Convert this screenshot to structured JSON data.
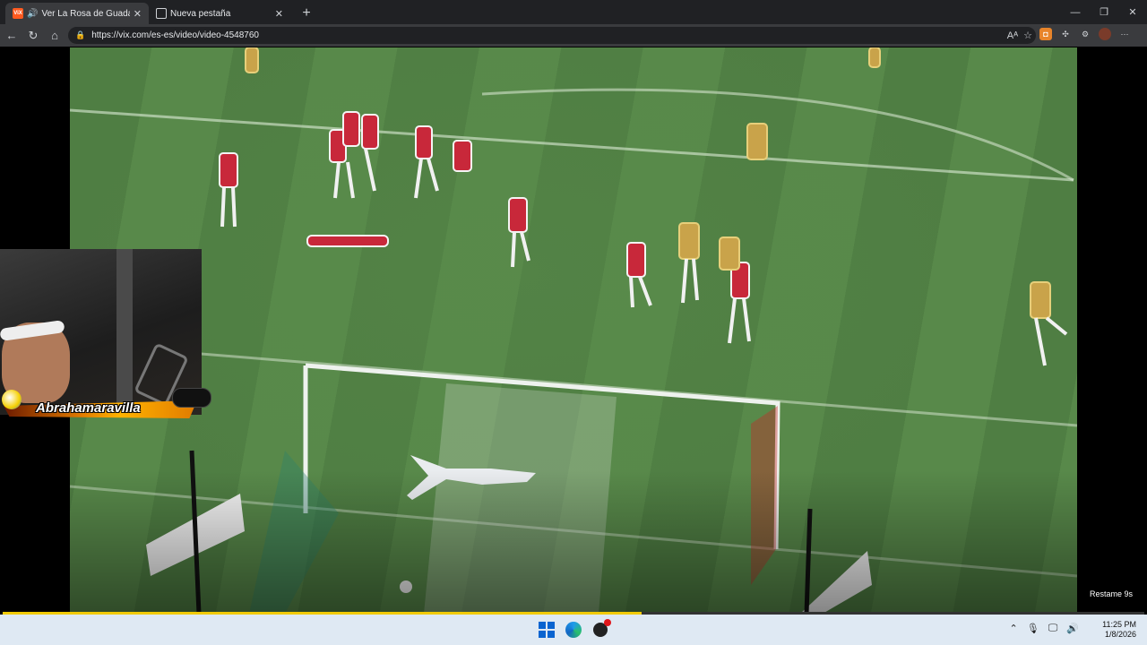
{
  "browser": {
    "tabs": [
      {
        "title": "Ver La Rosa de Guadalupe, ca|",
        "favicon": "vix-favicon",
        "active": true,
        "playing_audio": true
      },
      {
        "title": "Nueva pestaña",
        "favicon": "new-tab-favicon",
        "active": false
      }
    ],
    "address": "https://vix.com/es-es/video/video-4548760",
    "accent_color": "#ff5a1f"
  },
  "player": {
    "remaining_label": "Restame 9s",
    "progress": 0.56,
    "progress_color": "#f2cb05"
  },
  "overlay": {
    "streamer_name": "Abrahamaravilla"
  },
  "taskbar": {
    "time": "11:25 PM",
    "date": "1/8/2026"
  }
}
